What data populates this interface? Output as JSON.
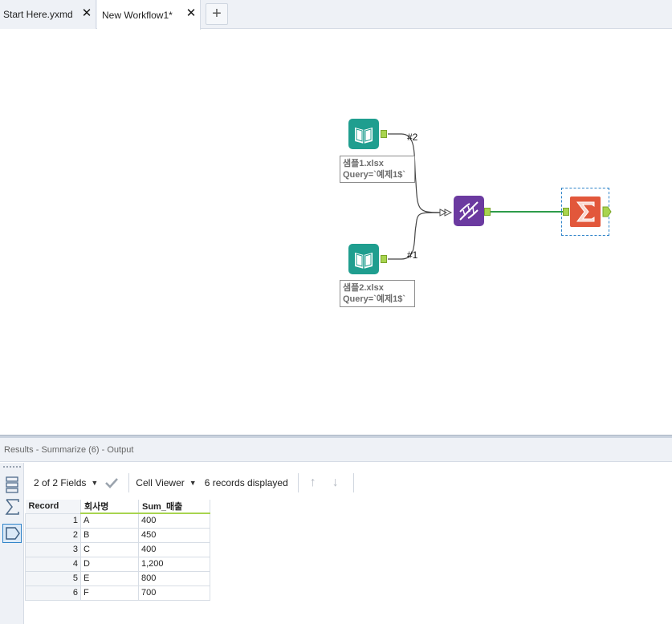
{
  "tabs": [
    {
      "label": "Start Here.yxmd",
      "close": "✕"
    },
    {
      "label": "New Workflow1*",
      "close": "✕"
    }
  ],
  "add_tab": "+",
  "canvas": {
    "input1": {
      "annotation_line1": "샘플1.xlsx",
      "annotation_line2": "Query=`예제1$`"
    },
    "input2": {
      "annotation_line1": "샘플2.xlsx",
      "annotation_line2": "Query=`예제1$`"
    },
    "conn_label_top": "#2",
    "conn_label_bottom": "#1",
    "colors": {
      "input": "#1f9e8f",
      "join": "#6b3aa0",
      "summarize": "#e2573b",
      "anchor": "#a8d44e",
      "connection": "#2e9c4a"
    }
  },
  "results": {
    "title": "Results - Summarize (6) - Output",
    "fields": "2 of 2 Fields",
    "viewer": "Cell Viewer",
    "records_displayed": "6 records displayed",
    "columns": [
      "Record",
      "회사명",
      "Sum_매출"
    ],
    "rows": [
      [
        "1",
        "A",
        "400"
      ],
      [
        "2",
        "B",
        "450"
      ],
      [
        "3",
        "C",
        "400"
      ],
      [
        "4",
        "D",
        "1,200"
      ],
      [
        "5",
        "E",
        "800"
      ],
      [
        "6",
        "F",
        "700"
      ]
    ]
  }
}
